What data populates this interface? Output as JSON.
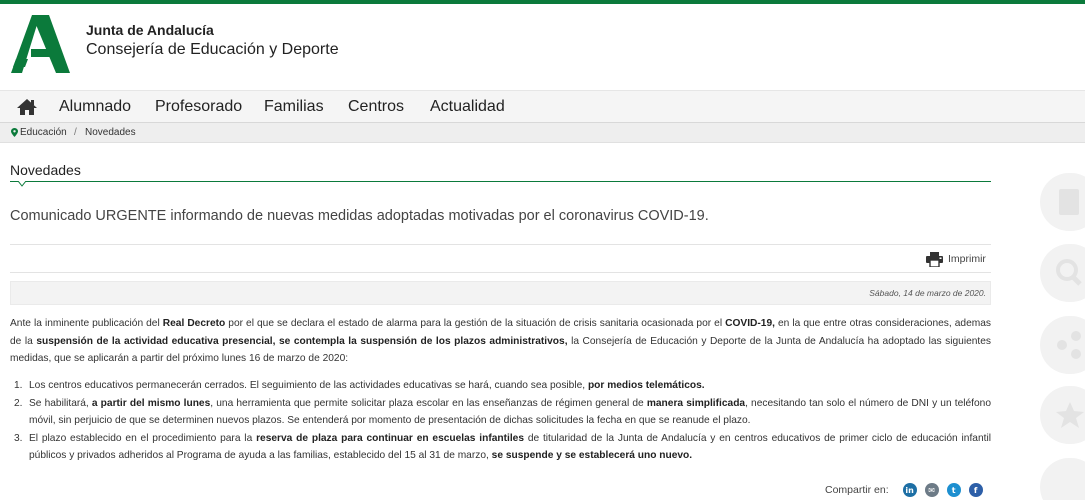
{
  "header": {
    "org": "Junta de Andalucía",
    "department": "Consejería de Educación y Deporte"
  },
  "nav": {
    "items": [
      "Alumnado",
      "Profesorado",
      "Familias",
      "Centros",
      "Actualidad"
    ]
  },
  "breadcrumb": {
    "items": [
      "Educación",
      "Novedades"
    ],
    "separator": "/"
  },
  "section": {
    "title": "Novedades"
  },
  "article": {
    "headline": "Comunicado URGENTE informando de nuevas medidas adoptadas motivadas por el coronavirus COVID-19.",
    "print_label": "Imprimir",
    "date": "Sábado, 14 de marzo de 2020.",
    "intro": {
      "p1": "Ante la inminente publicación del ",
      "b1": "Real Decreto",
      "p2": " por el que se declara el estado de alarma para la gestión de la situación de crisis sanitaria ocasionada por el ",
      "b2": "COVID-19,",
      "p3": " en la que entre otras consideraciones, ademas de la ",
      "b3": "suspensión de la actividad educativa presencial, se contempla la suspensión de los plazos administrativos,",
      "p4": " la Consejería de Educación y Deporte de la Junta de Andalucía ha adoptado las siguientes medidas, que se aplicarán a partir del próximo lunes 16 de marzo de 2020:"
    },
    "measures": [
      {
        "num": "1.",
        "t1": "Los centros educativos permanecerán cerrados. El seguimiento de las actividades educativas se hará, cuando sea posible, ",
        "b1": "por medios telemáticos.",
        "t2": ""
      },
      {
        "num": "2.",
        "t1": "Se habilitará, ",
        "b1": "a partir del mismo lunes",
        "t2": ", una herramienta que permite solicitar plaza escolar en las enseñanzas de régimen general de ",
        "b2": "manera simplificada",
        "t3": ", necesitando tan solo el número de DNI y un teléfono móvil, sin perjuicio de que se determinen nuevos plazos. Se entenderá por momento de presentación de dichas solicitudes la fecha en que se reanude el plazo."
      },
      {
        "num": "3.",
        "t1": "El plazo establecido en el procedimiento para la ",
        "b1": "reserva de plaza para continuar en escuelas infantiles",
        "t2": " de titularidad de la Junta de Andalucía y en centros educativos de primer ciclo de educación infantil públicos y privados adheridos al Programa de ayuda a las familias, establecido del 15 al 31 de marzo, ",
        "b2": "se suspende y se establecerá uno nuevo."
      }
    ],
    "share_label": "Compartir en:",
    "share_icons": [
      "linkedin-icon",
      "email-icon",
      "twitter-icon",
      "facebook-icon"
    ],
    "share_glyphs": [
      "in",
      "✉",
      "t",
      "f"
    ]
  },
  "colors": {
    "brand_green": "#0b7a3b",
    "linkedin": "#1d6fa5",
    "email": "#6d7b87",
    "twitter": "#1d8fd0",
    "facebook": "#2d5fa8"
  }
}
